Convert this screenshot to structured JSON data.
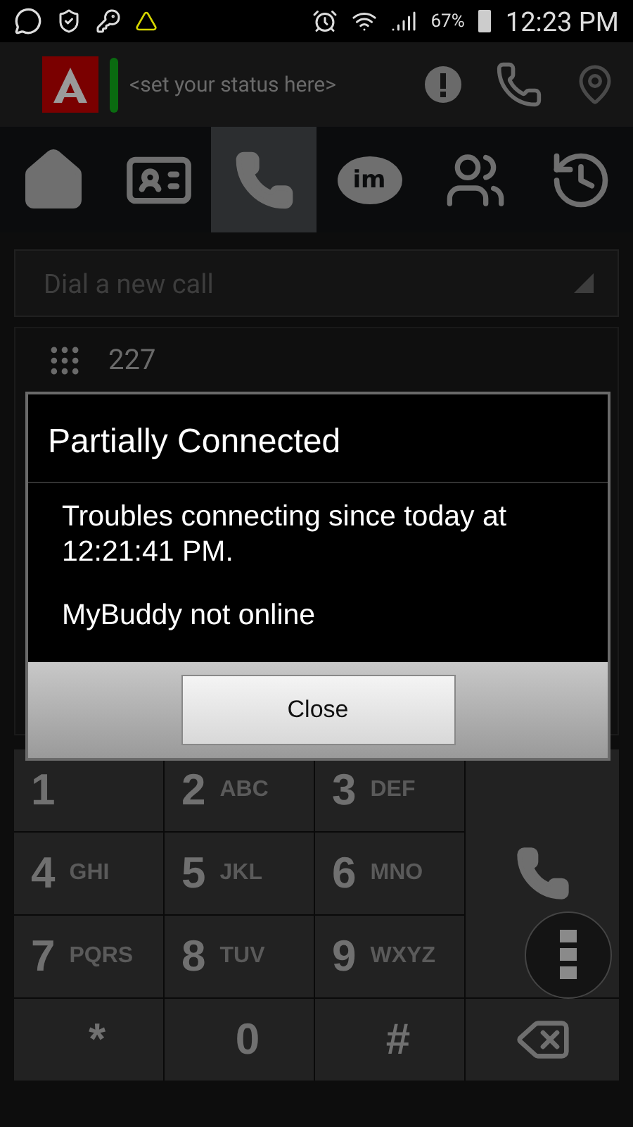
{
  "status_bar": {
    "battery": "67%",
    "time": "12:23 PM"
  },
  "header": {
    "status_placeholder": "<set your status here>"
  },
  "tabs": [
    {
      "kind": "home",
      "selected": false
    },
    {
      "kind": "contacts",
      "selected": false
    },
    {
      "kind": "dialer",
      "selected": true
    },
    {
      "kind": "im",
      "text": "im",
      "selected": false
    },
    {
      "kind": "conference",
      "selected": false
    },
    {
      "kind": "history",
      "selected": false
    }
  ],
  "dial_field": {
    "placeholder": "Dial a new call"
  },
  "recent_entry": {
    "number": "227"
  },
  "keypad": {
    "keys": [
      {
        "digit": "1"
      },
      {
        "digit": "2",
        "letters": "ABC"
      },
      {
        "digit": "3",
        "letters": "DEF"
      },
      {
        "digit": "4",
        "letters": "GHI"
      },
      {
        "digit": "5",
        "letters": "JKL"
      },
      {
        "digit": "6",
        "letters": "MNO"
      },
      {
        "digit": "7",
        "letters": "PQRS"
      },
      {
        "digit": "8",
        "letters": "TUV"
      },
      {
        "digit": "9",
        "letters": "WXYZ"
      },
      {
        "digit": "*"
      },
      {
        "digit": "0"
      },
      {
        "digit": "#"
      }
    ]
  },
  "dialog": {
    "title": "Partially Connected",
    "paragraphs": [
      "Troubles connecting since today at 12:21:41 PM.",
      "MyBuddy not online"
    ],
    "button": "Close"
  }
}
